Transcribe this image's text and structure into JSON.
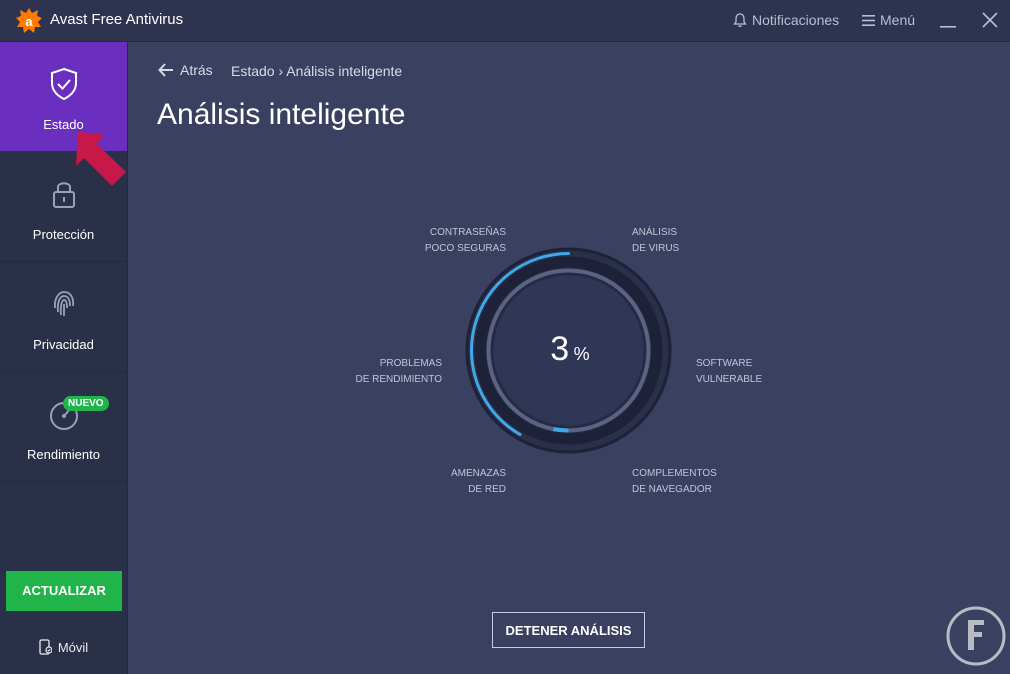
{
  "window": {
    "title": "Avast Free Antivirus",
    "notifications_label": "Notificaciones",
    "menu_label": "Menú"
  },
  "sidebar": {
    "items": [
      {
        "label": "Estado",
        "icon": "shield-check-icon",
        "active": true
      },
      {
        "label": "Protección",
        "icon": "lock-icon",
        "active": false
      },
      {
        "label": "Privacidad",
        "icon": "fingerprint-icon",
        "active": false
      },
      {
        "label": "Rendimiento",
        "icon": "speedometer-icon",
        "active": false,
        "badge": "NUEVO"
      }
    ],
    "update_button": "ACTUALIZAR",
    "mobile_label": "Móvil"
  },
  "main": {
    "back_label": "Atrás",
    "breadcrumb": "Estado › Análisis inteligente",
    "title": "Análisis inteligente",
    "progress_percent": 3,
    "percent_symbol": "%",
    "scan_areas": [
      {
        "line1": "CONTRASEÑAS",
        "line2": "POCO SEGURAS"
      },
      {
        "line1": "ANÁLISIS",
        "line2": "DE VIRUS"
      },
      {
        "line1": "SOFTWARE",
        "line2": "VULNERABLE"
      },
      {
        "line1": "COMPLEMENTOS",
        "line2": "DE NAVEGADOR"
      },
      {
        "line1": "AMENAZAS",
        "line2": "DE RED"
      },
      {
        "line1": "PROBLEMAS",
        "line2": "DE RENDIMIENTO"
      }
    ],
    "stop_button": "DETENER ANÁLISIS"
  },
  "colors": {
    "accent_purple": "#6b2fc0",
    "accent_green": "#20b44a",
    "progress_blue": "#3fa9e8",
    "background": "#3a4160"
  }
}
